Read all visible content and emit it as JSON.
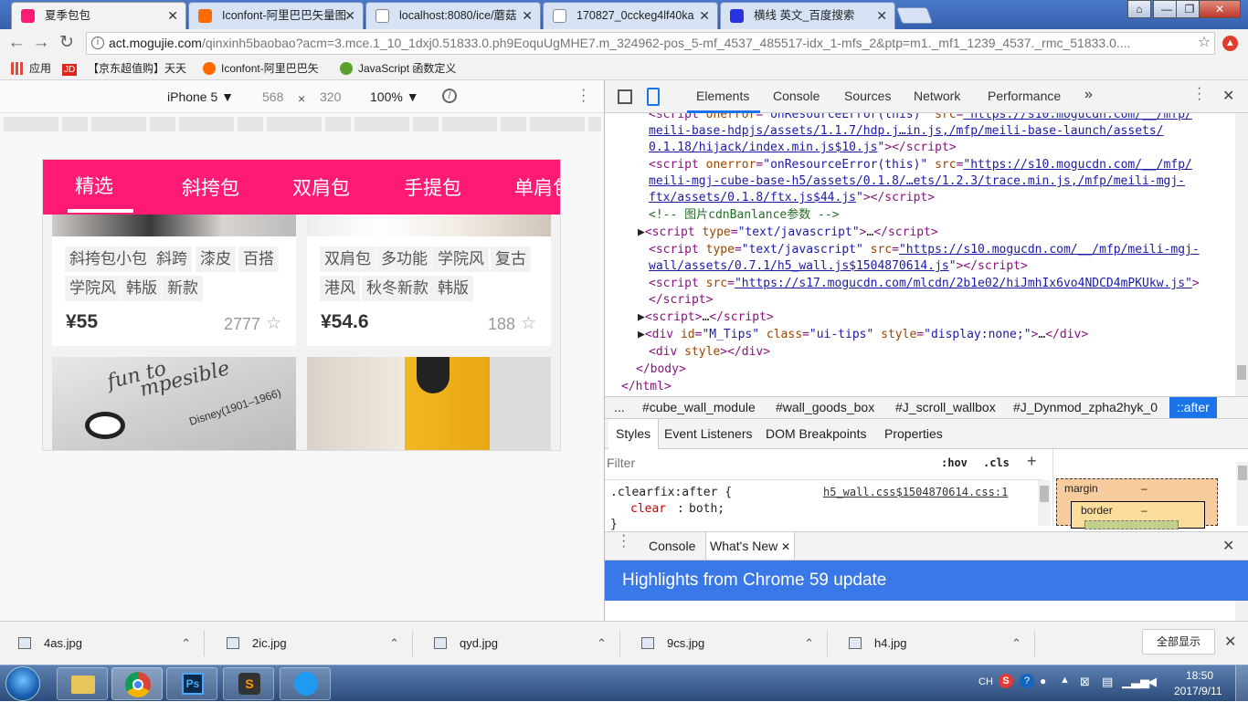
{
  "tabs": [
    {
      "title": "夏季包包",
      "color": "#ff1a75"
    },
    {
      "title": "Iconfont-阿里巴巴矢量图",
      "color": "#ff6a00"
    },
    {
      "title": "localhost:8080/ice/蘑菇",
      "color": "#888888"
    },
    {
      "title": "170827_0cckeg4lf40ka",
      "color": "#888888"
    },
    {
      "title": "横线 英文_百度搜索",
      "color": "#2932e1"
    }
  ],
  "window": {
    "minimize": "—",
    "maximize": "❐",
    "close": "✕"
  },
  "omnibox": {
    "host": "act.mogujie.com",
    "path": "/qinxinh5baobao?acm=3.mce.1_10_1dxj0.51833.0.ph9EoquUgMHE7.m_324962-pos_5-mf_4537_485517-idx_1-mfs_2&ptp=m1._mf1_1239_4537._rmc_51833.0...."
  },
  "bookmarks": [
    {
      "label": "应用",
      "color": "#e8453c"
    },
    {
      "label": "JD",
      "color": "#e1251b"
    },
    {
      "label": "【京东超值购】天天",
      "color": "#ffffff"
    },
    {
      "label": "Iconfont-阿里巴巴矢",
      "color": "#ff6a00"
    },
    {
      "label": "JavaScript 函数定义",
      "color": "#5aa02c"
    }
  ],
  "device": {
    "model": "iPhone 5 ▼",
    "width": "568",
    "times": "×",
    "height": "320",
    "zoom": "100% ▼"
  },
  "phone": {
    "tabs": [
      "精选",
      "斜挎包",
      "双肩包",
      "手提包",
      "单肩包"
    ],
    "products": [
      {
        "tags_row1": [
          "斜挎包小包",
          "斜跨",
          "漆皮",
          "百搭"
        ],
        "tags_row2": [
          "学院风",
          "韩版",
          "新款"
        ],
        "price": "¥55",
        "likes": "2777"
      },
      {
        "tags_row1": [
          "双肩包",
          "多功能",
          "学院风",
          "复古"
        ],
        "tags_row2": [
          "港风",
          "秋冬新款",
          "韩版"
        ],
        "price": "¥54.6",
        "likes": "188"
      }
    ],
    "img_text1": "fun to",
    "img_text2": "mpesible",
    "img_text3": "Disney(1901–1966)"
  },
  "devtools": {
    "tabs": [
      "Elements",
      "Console",
      "Sources",
      "Network",
      "Performance",
      "»"
    ],
    "breadcrumbs": [
      "...",
      "#cube_wall_module",
      "#wall_goods_box",
      "#J_scroll_wallbox",
      "#J_Dynmod_zpha2hyk_0",
      "::after"
    ],
    "subtabs": [
      "Styles",
      "Event Listeners",
      "DOM Breakpoints",
      "Properties"
    ],
    "filter_placeholder": "Filter",
    "hov": ":hov",
    "cls": ".cls",
    "rule_selector": ".clearfix:after {",
    "rule_source": "h5_wall.css$1504870614.css:1",
    "rule_prop": "clear",
    "rule_val": "both;",
    "rule_close": "}",
    "box": {
      "margin": "margin",
      "border": "border",
      "dash": "–"
    },
    "drawer": {
      "console": "Console",
      "whatsnew": "What's New"
    },
    "highlight": "Highlights from Chrome 59 update"
  },
  "downloads": [
    {
      "name": "4as.jpg"
    },
    {
      "name": "2ic.jpg"
    },
    {
      "name": "qyd.jpg"
    },
    {
      "name": "9cs.jpg"
    },
    {
      "name": "h4.jpg"
    }
  ],
  "show_all": "全部显示",
  "tray": {
    "ime": "CH",
    "time": "18:50",
    "date": "2017/9/11"
  }
}
